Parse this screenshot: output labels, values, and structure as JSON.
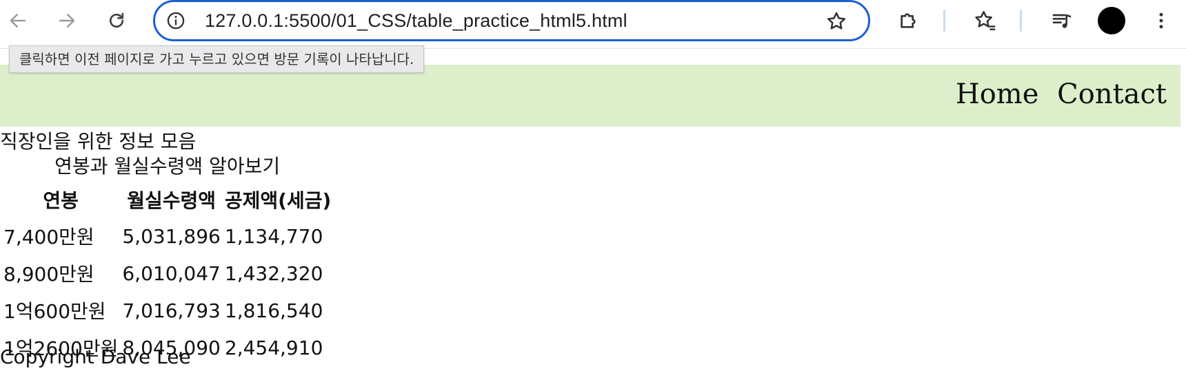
{
  "browser": {
    "url": "127.0.0.1:5500/01_CSS/table_practice_html5.html",
    "icons": {
      "back": "arrow-left-icon",
      "forward": "arrow-right-icon",
      "reload": "reload-icon",
      "site_info": "info-icon",
      "bookmark": "star-icon",
      "extensions": "puzzle-icon",
      "bookmarks_manager": "star-list-icon",
      "media": "playlist-icon",
      "menu": "kebab-menu-icon"
    },
    "accent_color": "#1a5fd0"
  },
  "tooltip": {
    "text": "클릭하면 이전 페이지로 가고 누르고 있으면 방문 기록이 나타납니다."
  },
  "header": {
    "background": "#dcefca",
    "nav": {
      "home": "Home",
      "contact": "Contact"
    }
  },
  "main": {
    "title": "직장인을 위한 정보 모음",
    "table": {
      "caption": "연봉과 월실수령액 알아보기",
      "headers": [
        "연봉",
        "월실수령액",
        "공제액(세금)"
      ],
      "rows": [
        [
          "7,400만원",
          "5,031,896",
          "1,134,770"
        ],
        [
          "8,900만원",
          "6,010,047",
          "1,432,320"
        ],
        [
          "1억600만원",
          "7,016,793",
          "1,816,540"
        ],
        [
          "1억2600만원",
          "8,045,090",
          "2,454,910"
        ]
      ]
    }
  },
  "footer": {
    "text": "Copyright Dave Lee"
  }
}
